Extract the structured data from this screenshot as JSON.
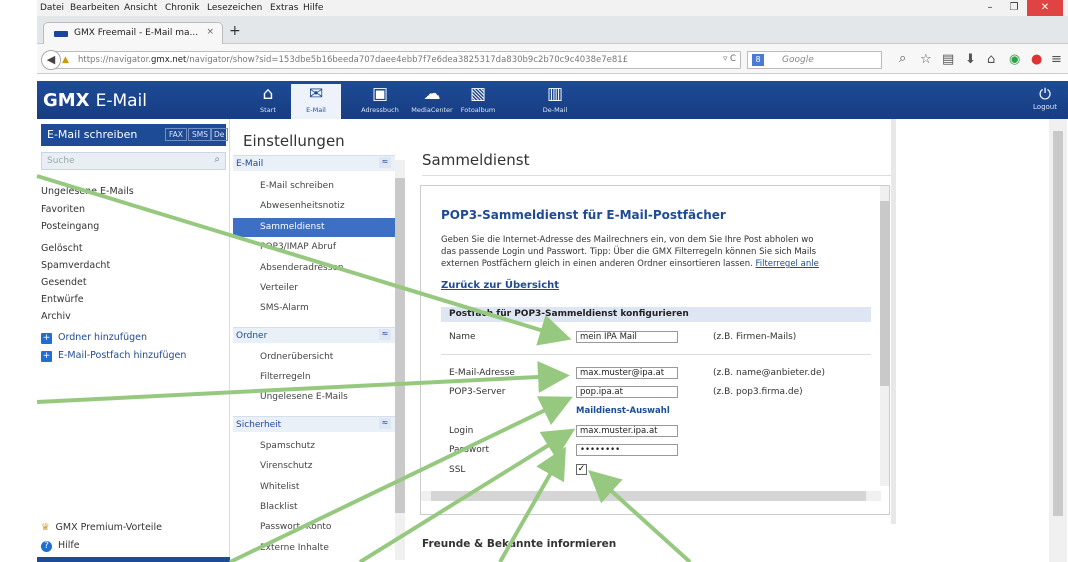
{
  "menubar": {
    "items": [
      "Datei",
      "Bearbeiten",
      "Ansicht",
      "Chronik",
      "Lesezeichen",
      "Extras",
      "Hilfe"
    ]
  },
  "browser": {
    "tab_title": "GMX Freemail - E-Mail ma...",
    "url_host": "https://navigator.",
    "url_domain": "gmx.net",
    "url_rest": "/navigator/show?sid=153dbe5b16beeda707daee4ebb7f7e6dea3825317da830b9c2b70c9c4038e7e81£",
    "search_placeholder": "Google",
    "search_engine_badge": "8"
  },
  "gmx_header": {
    "brand": "GMX",
    "product": "E-Mail",
    "nav": [
      {
        "label": "Start",
        "icon": "home-icon"
      },
      {
        "label": "E-Mail",
        "icon": "mail-icon"
      },
      {
        "label": "Adressbuch",
        "icon": "address-book-icon"
      },
      {
        "label": "MediaCenter",
        "icon": "cloud-icon"
      },
      {
        "label": "Fotoalbum",
        "icon": "photo-icon"
      },
      {
        "label": "De-Mail",
        "icon": "demail-icon"
      }
    ],
    "logout": "Logout"
  },
  "sidebar": {
    "compose": "E-Mail schreiben",
    "fax": "FAX",
    "sms": "SMS",
    "de": "De",
    "search_placeholder": "Suche",
    "folders": [
      "Ungelesene E-Mails",
      "Favoriten",
      "Posteingang",
      "Gelöscht",
      "Spamverdacht",
      "Gesendet",
      "Entwürfe",
      "Archiv"
    ],
    "add_folder": "Ordner hinzufügen",
    "add_mailbox": "E-Mail-Postfach hinzufügen",
    "premium": "GMX Premium-Vorteile",
    "help": "Hilfe"
  },
  "settings": {
    "title": "Einstellungen",
    "sections": [
      {
        "name": "E-Mail",
        "items": [
          "E-Mail schreiben",
          "Abwesenheitsnotiz",
          "Sammeldienst",
          "POP3/IMAP Abruf",
          "Absenderadressen",
          "Verteiler",
          "SMS-Alarm"
        ]
      },
      {
        "name": "Ordner",
        "items": [
          "Ordnerübersicht",
          "Filterregeln",
          "Ungelesene E-Mails"
        ]
      },
      {
        "name": "Sicherheit",
        "items": [
          "Spamschutz",
          "Virenschutz",
          "Whitelist",
          "Blacklist",
          "Passwort, Konto",
          "Externe Inhalte"
        ]
      }
    ],
    "active_item": "Sammeldienst"
  },
  "main": {
    "heading": "Sammeldienst",
    "panel_title": "POP3-Sammeldienst für E-Mail-Postfächer",
    "desc_line1": "Geben Sie die Internet-Adresse des Mailrechners ein, von dem Sie Ihre Post abholen wo",
    "desc_line2": "das passende Login und Passwort. Tipp: Über die GMX Filterregeln können Sie sich Mails",
    "desc_line3_pre": "externen Postfächern gleich in einen anderen Ordner einsortieren lassen. ",
    "desc_line3_link": "Filterregel anle",
    "back_link": "Zurück zur Übersicht",
    "form_header": "Postfach für POP3-Sammeldienst konfigurieren",
    "fields": {
      "name_label": "Name",
      "name_value": "mein IPA Mail",
      "name_hint": "(z.B. Firmen-Mails)",
      "email_label": "E-Mail-Adresse",
      "email_value": "max.muster@ipa.at",
      "email_hint": "(z.B. name@anbieter.de)",
      "server_label": "POP3-Server",
      "server_value": "pop.ipa.at",
      "server_hint": "(z.B. pop3.firma.de)",
      "maildienst": "Maildienst-Auswahl",
      "login_label": "Login",
      "login_value": "max.muster.ipa.at",
      "password_label": "Passwort",
      "password_value": "••••••••",
      "ssl_label": "SSL",
      "ssl_checked": true
    },
    "footer_heading": "Freunde & Bekannte informieren"
  },
  "colors": {
    "gmx_blue": "#1e4b96",
    "active_item": "#3d6fc5",
    "arrow_green": "#96c97f"
  }
}
